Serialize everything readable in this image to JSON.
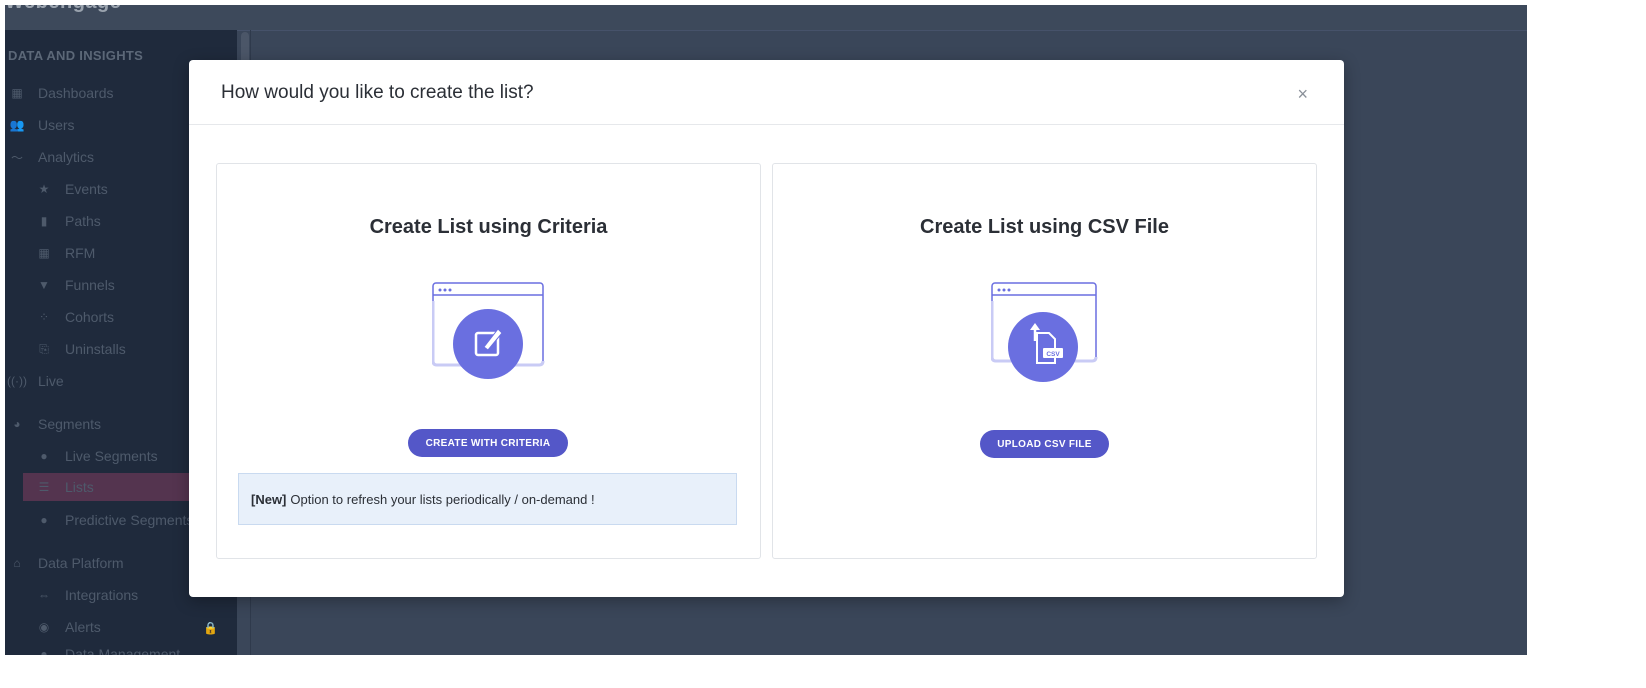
{
  "brand": "Webengage",
  "sidebar": {
    "section_data": "DATA AND INSIGHTS",
    "items": [
      {
        "label": "Dashboards",
        "icon": "dashboard-icon"
      },
      {
        "label": "Users",
        "icon": "users-icon"
      },
      {
        "label": "Analytics",
        "icon": "analytics-icon"
      },
      {
        "label": "Events",
        "icon": "star-icon"
      },
      {
        "label": "Paths",
        "icon": "bar-chart-icon"
      },
      {
        "label": "RFM",
        "icon": "grid-icon"
      },
      {
        "label": "Funnels",
        "icon": "funnel-icon"
      },
      {
        "label": "Cohorts",
        "icon": "cohort-icon"
      },
      {
        "label": "Uninstalls",
        "icon": "uninstall-icon"
      },
      {
        "label": "Live",
        "icon": "broadcast-icon"
      },
      {
        "label": "Segments",
        "icon": "pie-icon"
      },
      {
        "label": "Live Segments",
        "icon": "live-segment-icon"
      },
      {
        "label": "Lists",
        "icon": "list-icon"
      },
      {
        "label": "Predictive Segments",
        "icon": "bulb-icon"
      },
      {
        "label": "Data Platform",
        "icon": "platform-icon"
      },
      {
        "label": "Integrations",
        "icon": "integrations-icon"
      },
      {
        "label": "Alerts",
        "icon": "alerts-icon"
      },
      {
        "label": "Data Management",
        "icon": "data-icon"
      }
    ]
  },
  "modal": {
    "title": "How would you like to create the list?",
    "close": "×",
    "criteria": {
      "title": "Create List using Criteria",
      "button": "CREATE WITH CRITERIA",
      "notice_tag": "[New]",
      "notice_text": "Option to refresh your lists periodically / on-demand !"
    },
    "csv": {
      "title": "Create List using CSV File",
      "button": "UPLOAD CSV FILE",
      "file_badge": "CSV"
    }
  },
  "colors": {
    "accent": "#5457c8",
    "illustration": "#6a6fe0",
    "backdrop": "#3a4659",
    "notice_bg": "#e8f0fa"
  }
}
